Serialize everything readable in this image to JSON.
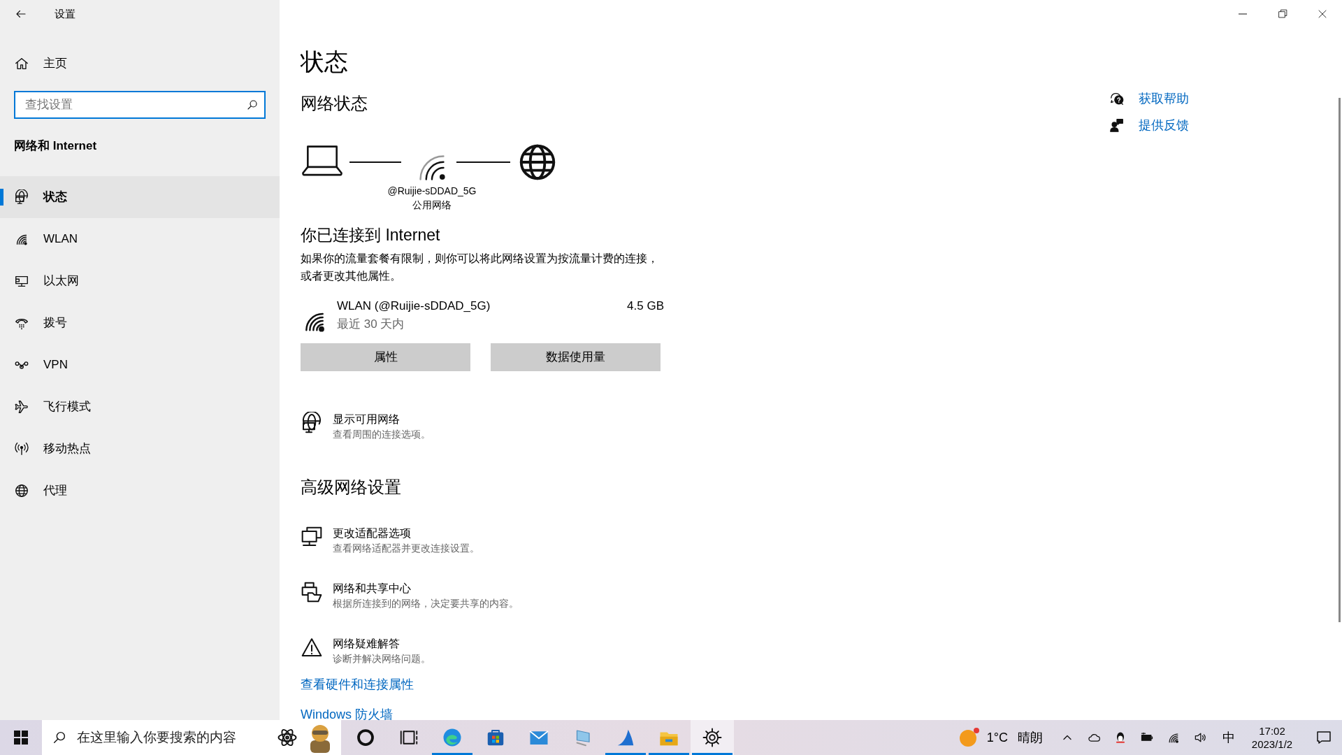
{
  "window": {
    "title": "设置"
  },
  "sidebar": {
    "home": "主页",
    "search": {
      "placeholder": "查找设置"
    },
    "section": "网络和 Internet",
    "items": [
      {
        "label": "状态",
        "kind": "status",
        "selected": true
      },
      {
        "label": "WLAN",
        "kind": "wlan",
        "selected": false
      },
      {
        "label": "以太网",
        "kind": "ethernet",
        "selected": false
      },
      {
        "label": "拨号",
        "kind": "dialup",
        "selected": false
      },
      {
        "label": "VPN",
        "kind": "vpn",
        "selected": false
      },
      {
        "label": "飞行模式",
        "kind": "airplane",
        "selected": false
      },
      {
        "label": "移动热点",
        "kind": "hotspot",
        "selected": false
      },
      {
        "label": "代理",
        "kind": "proxy",
        "selected": false
      }
    ]
  },
  "main": {
    "title": "状态",
    "network_status": {
      "heading": "网络状态",
      "network_name": "@Ruijie-sDDAD_5G",
      "network_type": "公用网络"
    },
    "connected": {
      "heading": "你已连接到 Internet",
      "description": "如果你的流量套餐有限制，则你可以将此网络设置为按流量计费的连接，或者更改其他属性。"
    },
    "usage": {
      "name": "WLAN (@Ruijie-sDDAD_5G)",
      "period": "最近 30 天内",
      "amount": "4.5 GB"
    },
    "buttons": [
      "属性",
      "数据使用量"
    ],
    "show_networks": {
      "title": "显示可用网络",
      "description": "查看周围的连接选项。"
    },
    "advanced": {
      "heading": "高级网络设置",
      "items": [
        {
          "kind": "adapter",
          "title": "更改适配器选项",
          "description": "查看网络适配器并更改连接设置。"
        },
        {
          "kind": "sharing",
          "title": "网络和共享中心",
          "description": "根据所连接到的网络，决定要共享的内容。"
        },
        {
          "kind": "troubleshoot",
          "title": "网络疑难解答",
          "description": "诊断并解决网络问题。"
        }
      ]
    },
    "links": [
      "查看硬件和连接属性",
      "Windows 防火墙"
    ]
  },
  "help": [
    {
      "kind": "help",
      "label": "获取帮助"
    },
    {
      "kind": "feedback",
      "label": "提供反馈"
    }
  ],
  "taskbar": {
    "search": {
      "placeholder": "在这里输入你要搜索的内容"
    },
    "apps": [
      {
        "kind": "cortana",
        "running": false,
        "selected": false
      },
      {
        "kind": "taskview",
        "running": false,
        "selected": false
      },
      {
        "kind": "edge",
        "running": true,
        "selected": false
      },
      {
        "kind": "store",
        "running": false,
        "selected": false
      },
      {
        "kind": "mail",
        "running": false,
        "selected": false
      },
      {
        "kind": "pc",
        "running": false,
        "selected": false
      },
      {
        "kind": "fin",
        "running": true,
        "selected": false
      },
      {
        "kind": "explorer",
        "running": true,
        "selected": false
      },
      {
        "kind": "settings",
        "running": true,
        "selected": true
      }
    ],
    "weather": {
      "temperature": "1°C",
      "condition": "晴朗"
    },
    "input_method": "中",
    "time": "17:02",
    "date": "2023/1/2"
  }
}
